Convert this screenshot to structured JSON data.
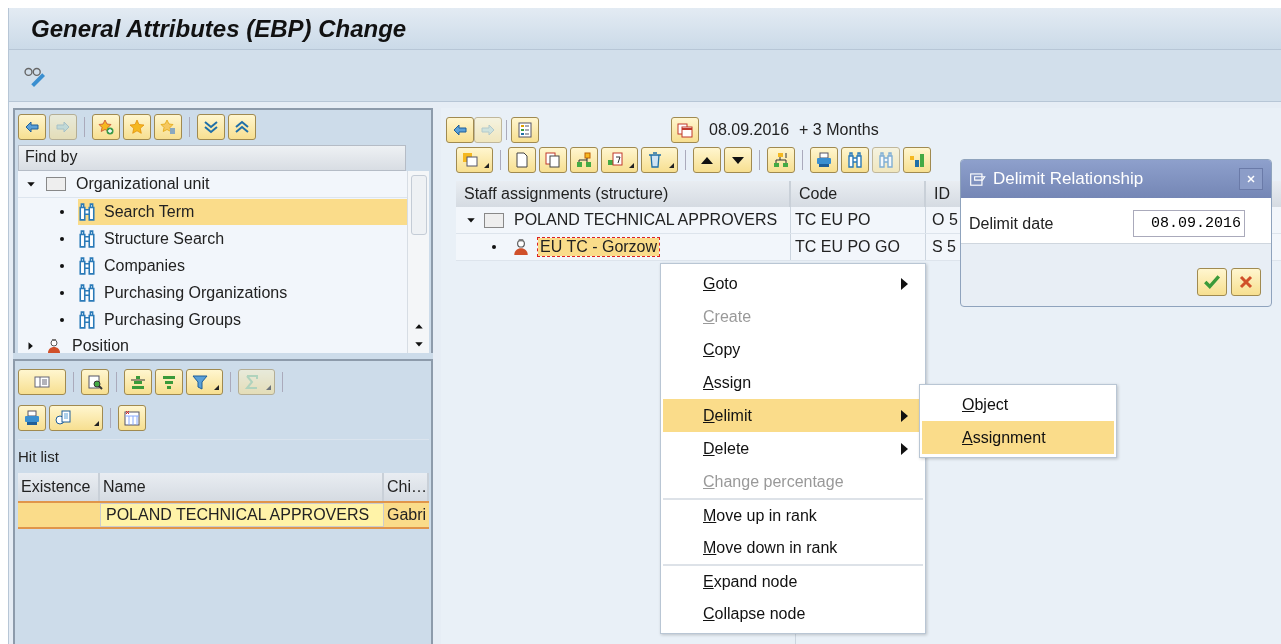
{
  "window": {
    "title": "General Attributes (EBP) Change"
  },
  "find_by": {
    "heading": "Find by",
    "tree": [
      {
        "label": "Organizational unit",
        "kind": "folder",
        "expanded": true,
        "selected": false,
        "children": [
          {
            "label": "Search Term",
            "kind": "search",
            "selected": true
          },
          {
            "label": "Structure Search",
            "kind": "search",
            "selected": false
          },
          {
            "label": "Companies",
            "kind": "search",
            "selected": false
          },
          {
            "label": "Purchasing Organizations",
            "kind": "search",
            "selected": false
          },
          {
            "label": "Purchasing Groups",
            "kind": "search",
            "selected": false
          }
        ]
      },
      {
        "label": "Position",
        "kind": "person",
        "expanded": false,
        "selected": false
      }
    ]
  },
  "hit_list": {
    "title": "Hit list",
    "columns": [
      "Existence",
      "Name",
      "Chi…"
    ],
    "rows": [
      {
        "name": "POLAND TECHNICAL APPROVERS",
        "column_3": "Gabri",
        "selected": true
      }
    ]
  },
  "date_bar": {
    "date": "08.09.2016",
    "period": "+ 3 Months"
  },
  "structure": {
    "columns": [
      "Staff assignments (structure)",
      "Code",
      "ID"
    ],
    "tree": [
      {
        "label": "POLAND TECHNICAL APPROVERS",
        "code": "TC EU PO",
        "id": "O 5",
        "kind": "folder",
        "expanded": true,
        "selected": false,
        "children": [
          {
            "label": "EU TC - Gorzow",
            "code": "TC EU PO GO",
            "id": "S 5",
            "kind": "person",
            "selected": true
          }
        ]
      }
    ]
  },
  "context_menu": {
    "items": [
      {
        "label": "Goto",
        "disabled": false,
        "submenu": true,
        "separator_before": false,
        "selected": false
      },
      {
        "label": "Create",
        "disabled": true,
        "submenu": false,
        "separator_before": false,
        "selected": false
      },
      {
        "label": "Copy",
        "disabled": false,
        "submenu": false,
        "separator_before": false,
        "selected": false
      },
      {
        "label": "Assign",
        "disabled": false,
        "submenu": false,
        "separator_before": false,
        "selected": false
      },
      {
        "label": "Delimit",
        "disabled": false,
        "submenu": true,
        "separator_before": false,
        "selected": true
      },
      {
        "label": "Delete",
        "disabled": false,
        "submenu": true,
        "separator_before": false,
        "selected": false
      },
      {
        "label": "Change percentage",
        "disabled": true,
        "submenu": false,
        "separator_before": false,
        "selected": false
      },
      {
        "label": "Move up in rank",
        "disabled": false,
        "submenu": false,
        "separator_before": true,
        "selected": false
      },
      {
        "label": "Move down in rank",
        "disabled": false,
        "submenu": false,
        "separator_before": false,
        "selected": false
      },
      {
        "label": "Expand node",
        "disabled": false,
        "submenu": false,
        "separator_before": true,
        "selected": false
      },
      {
        "label": "Collapse node",
        "disabled": false,
        "submenu": false,
        "separator_before": false,
        "selected": false
      }
    ]
  },
  "submenu": {
    "items": [
      {
        "label": "Object",
        "selected": false
      },
      {
        "label": "Assignment",
        "selected": true
      }
    ]
  },
  "dialog": {
    "title": "Delimit Relationship",
    "field_label": "Delimit date",
    "field_value": "08.09.2016"
  }
}
